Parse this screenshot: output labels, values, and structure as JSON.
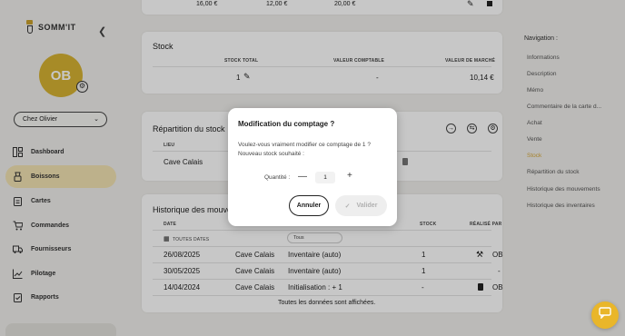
{
  "app": {
    "logo_text": "SOMM'IT"
  },
  "user": {
    "initials": "OB",
    "establishment": "Chez Olivier"
  },
  "sidebar": {
    "items": [
      {
        "label": "Dashboard",
        "icon": "dashboard-icon"
      },
      {
        "label": "Boissons",
        "icon": "wine-icon",
        "active": true
      },
      {
        "label": "Cartes",
        "icon": "clipboard-icon"
      },
      {
        "label": "Commandes",
        "icon": "cart-icon"
      },
      {
        "label": "Fournisseurs",
        "icon": "truck-icon"
      },
      {
        "label": "Pilotage",
        "icon": "chart-icon"
      },
      {
        "label": "Rapports",
        "icon": "report-icon"
      }
    ]
  },
  "top_row": {
    "values": [
      "16,00 €",
      "12,00 €",
      "20,00 €"
    ]
  },
  "stock": {
    "title": "Stock",
    "headers": {
      "total": "STOCK TOTAL",
      "accounting": "VALEUR COMPTABLE",
      "market": "VALEUR DE MARCHÉ"
    },
    "row": {
      "total": "1",
      "accounting": "-",
      "market": "10,14 €"
    }
  },
  "repartition": {
    "title": "Répartition du stock",
    "headers": {
      "location": "LIEU"
    },
    "rows": [
      {
        "location": "Cave Calais"
      }
    ]
  },
  "history": {
    "title": "Historique des mouvements",
    "headers": {
      "date": "DATE",
      "stock": "STOCK",
      "by": "RÉALISÉ PAR"
    },
    "filters": {
      "dates": "TOUTES DATES",
      "type": "Tous"
    },
    "rows": [
      {
        "date": "26/08/2025",
        "location": "Cave Calais",
        "type": "Inventaire (auto)",
        "stock": "1",
        "by": "OB"
      },
      {
        "date": "30/05/2025",
        "location": "Cave Calais",
        "type": "Inventaire (auto)",
        "stock": "1",
        "by": "-"
      },
      {
        "date": "14/04/2024",
        "location": "Cave Calais",
        "type": "Initialisation : + 1",
        "stock": "-",
        "by": "OB"
      }
    ],
    "footer": "Toutes les données sont affichées."
  },
  "right_nav": {
    "title": "Navigation :",
    "items": [
      {
        "label": "Informations"
      },
      {
        "label": "Description"
      },
      {
        "label": "Mémo"
      },
      {
        "label": "Commentaire de la carte d..."
      },
      {
        "label": "Achat"
      },
      {
        "label": "Vente"
      },
      {
        "label": "Stock",
        "active": true
      },
      {
        "label": "Répartition du stock"
      },
      {
        "label": "Historique des mouvements"
      },
      {
        "label": "Historique des inventaires"
      }
    ]
  },
  "modal": {
    "title": "Modification du comptage ?",
    "line1": "Voulez-vous vraiment modifier ce comptage de 1 ?",
    "line2": "Nouveau stock souhaité :",
    "quantity_label": "Quantité :",
    "quantity_value": "1",
    "cancel_label": "Annuler",
    "validate_label": "Valider"
  },
  "colors": {
    "accent": "#d6b233",
    "active_nav": "#f3e3b3",
    "chat": "#e9b62a"
  }
}
